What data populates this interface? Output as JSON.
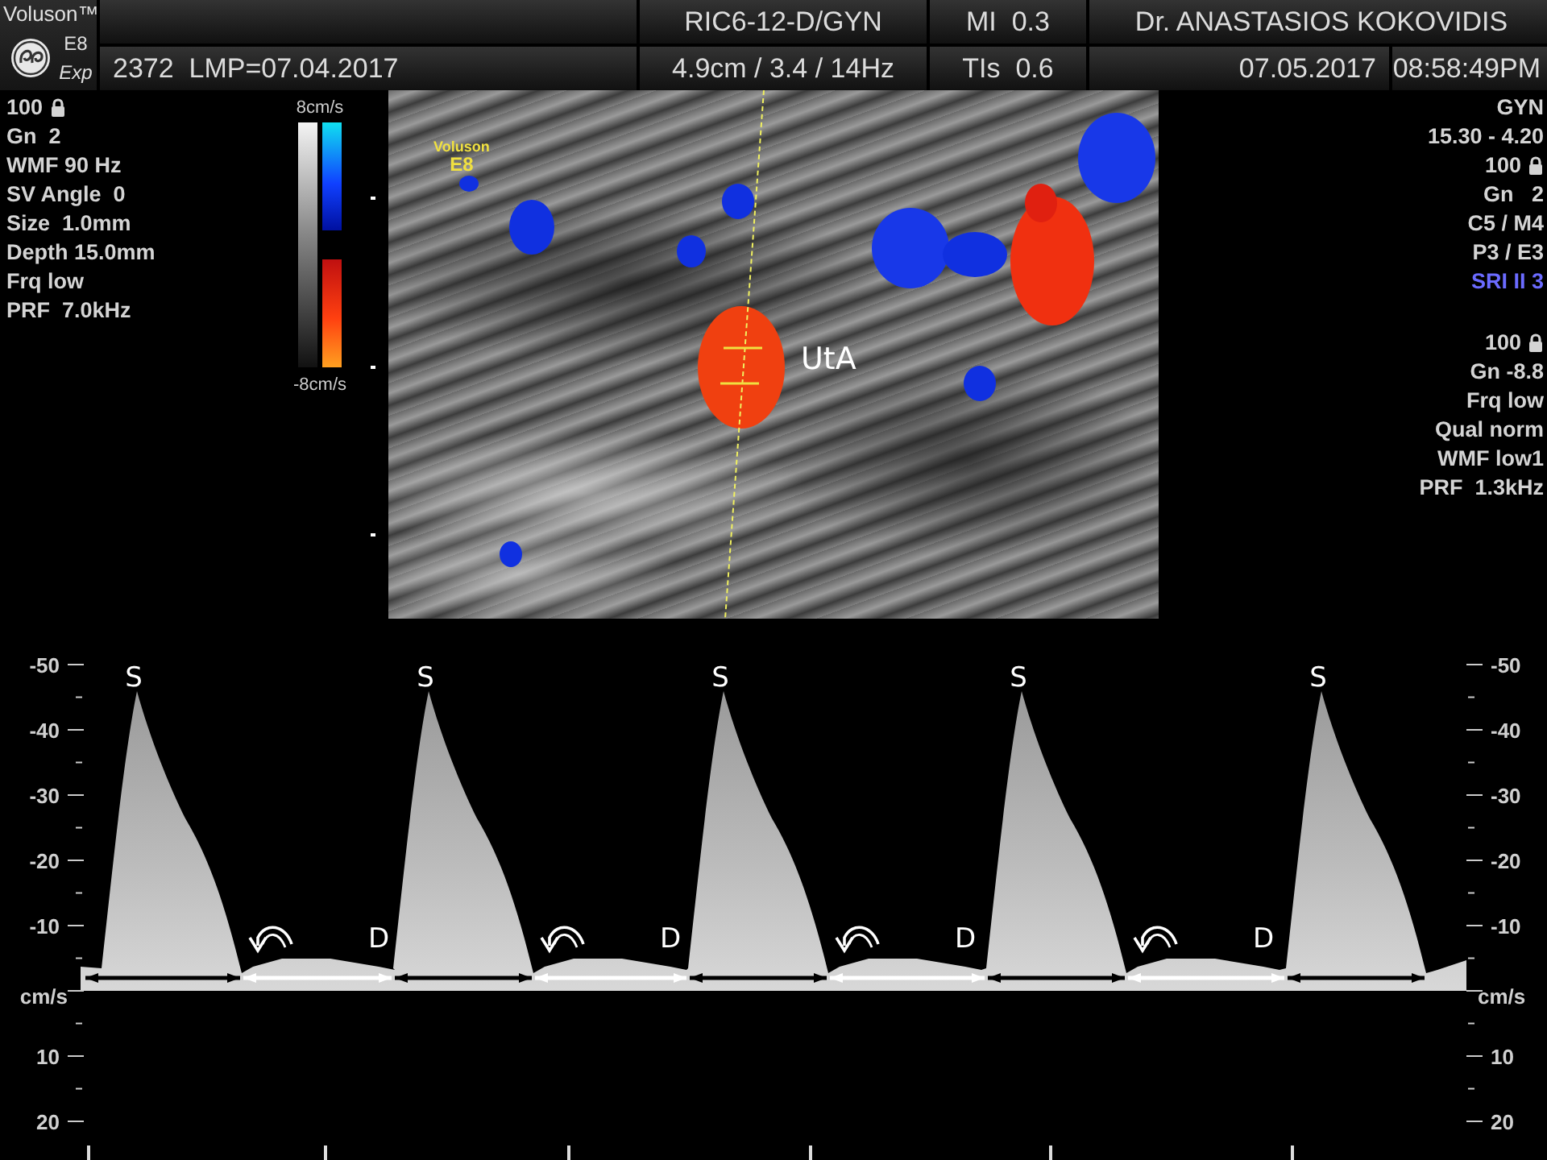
{
  "header": {
    "brand": "Voluson™",
    "model": "E8",
    "edition": "Exp",
    "probe": "RIC6-12-D/GYN",
    "mi": "MI  0.3",
    "operator": "Dr. ANASTASIOS KOKOVIDIS",
    "patient": "2372  LMP=07.04.2017",
    "depth_info": "4.9cm / 3.4 / 14Hz",
    "tis": "TIs  0.6",
    "date": "07.05.2017",
    "time": "08:58:49PM"
  },
  "left_params": [
    {
      "text": "100",
      "lock": true
    },
    {
      "text": "Gn  2",
      "lock": false
    },
    {
      "text": "WMF 90 Hz",
      "lock": false
    },
    {
      "text": "SV Angle  0",
      "lock": false
    },
    {
      "text": "Size  1.0mm",
      "lock": false
    },
    {
      "text": "Depth 15.0mm",
      "lock": false
    },
    {
      "text": "Frq low",
      "lock": false
    },
    {
      "text": "PRF  7.0kHz",
      "lock": false
    }
  ],
  "color_scale": {
    "top": "8cm/s",
    "bottom": "-8cm/s"
  },
  "image": {
    "overlay_label": [
      "Voluson",
      "E8"
    ],
    "vessel_label": "UtA"
  },
  "right_params": {
    "imaging": [
      {
        "text": "GYN",
        "kind": "normal",
        "lock": false
      },
      {
        "text": "15.30 - 4.20",
        "kind": "normal",
        "lock": false
      },
      {
        "text": "100",
        "kind": "normal",
        "lock": true
      },
      {
        "text": "Gn   2",
        "kind": "normal",
        "lock": false
      },
      {
        "text": "C5 / M4",
        "kind": "normal",
        "lock": false
      },
      {
        "text": "P3 / E3",
        "kind": "normal",
        "lock": false
      },
      {
        "text": "SRI II 3",
        "kind": "highlight",
        "lock": false
      }
    ],
    "doppler": [
      {
        "text": "100",
        "lock": true
      },
      {
        "text": "Gn -8.8",
        "lock": false
      },
      {
        "text": "Frq low",
        "lock": false
      },
      {
        "text": "Qual norm",
        "lock": false
      },
      {
        "text": "WMF low1",
        "lock": false
      },
      {
        "text": "PRF  1.3kHz",
        "lock": false
      }
    ]
  },
  "left_scale": [
    "-50",
    "-40",
    "-30",
    "-20",
    "-10",
    "cm/s",
    "10",
    "20"
  ],
  "right_scale": [
    "-50",
    "-40",
    "-30",
    "-20",
    "-10",
    "cm/s",
    "10",
    "20"
  ],
  "cycles": [
    {
      "peak": "S",
      "end_diastole": "D"
    },
    {
      "peak": "S",
      "end_diastole": "D"
    },
    {
      "peak": "S",
      "end_diastole": "D"
    },
    {
      "peak": "S",
      "end_diastole": "D"
    },
    {
      "peak": "S"
    }
  ]
}
